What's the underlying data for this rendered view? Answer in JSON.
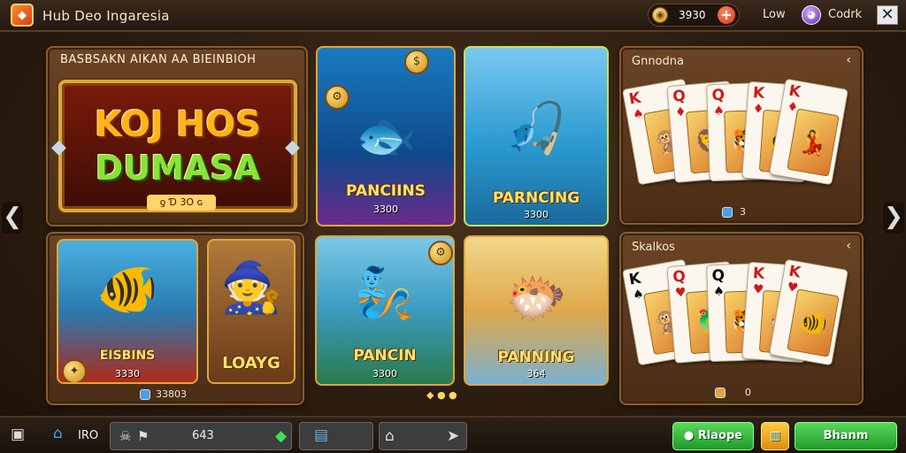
{
  "header": {
    "app_title": "Hub Deo Ingaresia",
    "coin_value": "3930",
    "plus_label": "+",
    "label_low": "Low",
    "label_profile": "Codrk",
    "close_glyph": "✕"
  },
  "nav": {
    "left_arrow": "❮",
    "right_arrow": "❯"
  },
  "banner": {
    "title": "BASBSAKN AIKAN AA BIEINBIOH",
    "logo_line1": "KOJ HOS",
    "logo_line2": "DUMASA",
    "logo_sub": "ƍ Ɗ 3O ɢ"
  },
  "games_top": [
    {
      "name": "PANCIINS",
      "value": "3300",
      "art": "🐟"
    },
    {
      "name": "PARNCING",
      "value": "3300",
      "art": "🎣"
    }
  ],
  "games_bottom_left": [
    {
      "name": "EISBINS",
      "value": "3330",
      "art": "🐠"
    },
    {
      "name": "LOAYG",
      "value": "",
      "art": "🧙"
    }
  ],
  "bottom_left_footer": "33803",
  "games_bottom_mid": [
    {
      "name": "PANCIN",
      "value": "3300",
      "art": "🧞"
    },
    {
      "name": "PANNING",
      "value": "364",
      "art": "🐡"
    }
  ],
  "card_panel_top": {
    "title": "Gnnodna",
    "chevron": "‹",
    "footer": "3",
    "cards": [
      {
        "rank": "K",
        "suit": "♠",
        "color": "red",
        "face": "🐒"
      },
      {
        "rank": "Q",
        "suit": "♦",
        "color": "red",
        "face": "🦁"
      },
      {
        "rank": "Q",
        "suit": "♠",
        "color": "red",
        "face": "🐯"
      },
      {
        "rank": "K",
        "suit": "♦",
        "color": "red",
        "face": "🐠"
      },
      {
        "rank": "K",
        "suit": "♦",
        "color": "red",
        "face": "💃"
      }
    ]
  },
  "card_panel_bottom": {
    "title": "Skalkos",
    "chevron": "‹",
    "footer": "0",
    "cards": [
      {
        "rank": "K",
        "suit": "♠",
        "color": "blk",
        "face": "🐒"
      },
      {
        "rank": "Q",
        "suit": "♥",
        "color": "red",
        "face": "🦜"
      },
      {
        "rank": "Q",
        "suit": "♠",
        "color": "blk",
        "face": "🐯"
      },
      {
        "rank": "K",
        "suit": "♥",
        "color": "red",
        "face": "🐡"
      },
      {
        "rank": "K",
        "suit": "♥",
        "color": "red",
        "face": "🐠"
      }
    ]
  },
  "bottombar": {
    "home_label": "IRO",
    "score": "643",
    "btn_left_label": "Rlaope",
    "btn_right_label": "Bhanm"
  },
  "colors": {
    "gold": "#e0a638",
    "green": "#1f9a2a",
    "wood": "#4a2d16"
  }
}
